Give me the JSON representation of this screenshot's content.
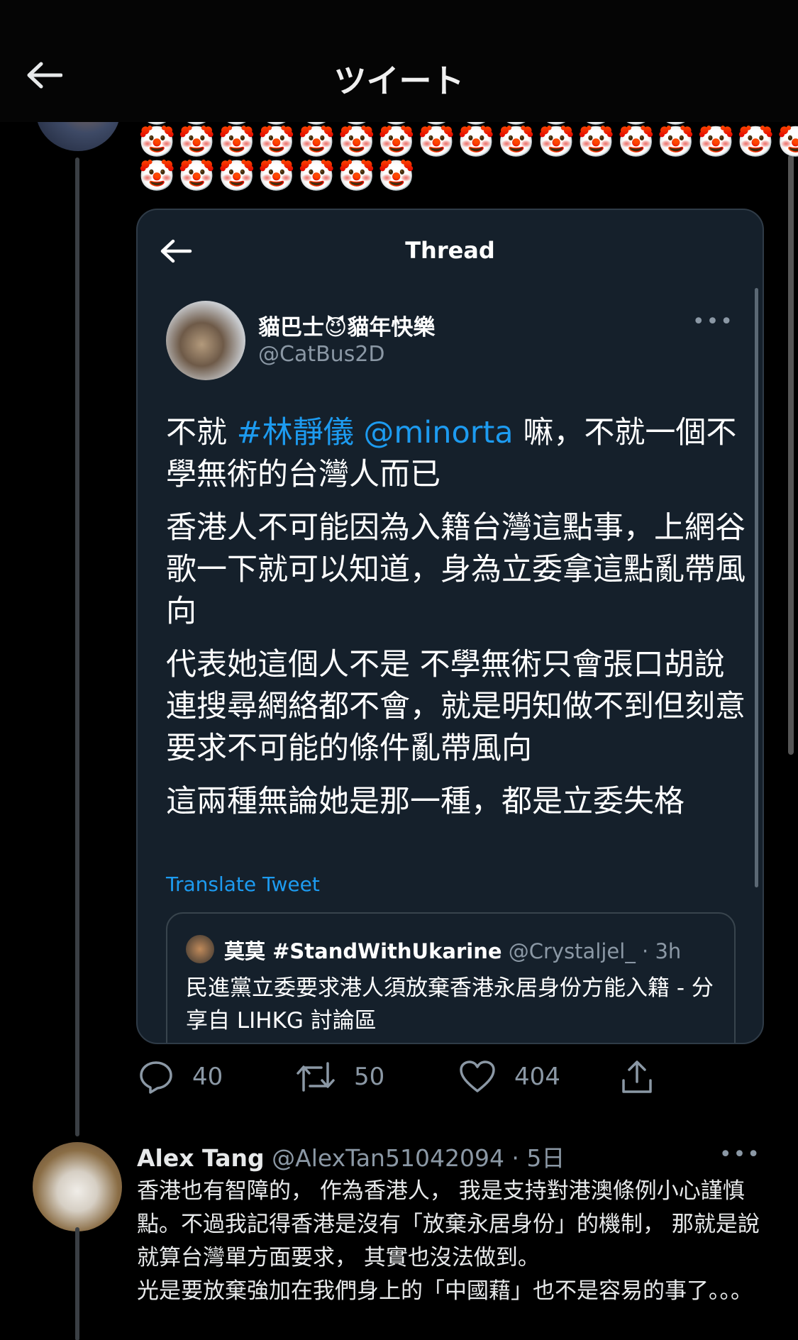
{
  "header": {
    "title": "ツイート"
  },
  "top_tweet": {
    "emoji_row_partial": "🤡🤡🤡🤡🤡🤡🤡🤡🤡🤡🤡🤡🤡🤡",
    "emoji_row_1": "🤡🤡🤡🤡🤡🤡🤡🤡🤡🤡🤡🤡🤡🤡🤡🤡🤡",
    "emoji_row_2": "🤡🤡🤡🤡🤡🤡🤡"
  },
  "embedded": {
    "title": "Thread",
    "author_name": "貓巴士😈貓年快樂",
    "author_handle": "@CatBus2D",
    "more": "•••",
    "p1_prefix": "不就 ",
    "p1_hashtag": "#林靜儀",
    "p1_space": " ",
    "p1_mention": "@minorta",
    "p1_suffix": " 嘛，不就一個不學無術的台灣人而已",
    "p2": "香港人不可能因為入籍台灣這點事，上網谷歌一下就可以知道，身為立委拿這點亂帶風向",
    "p3": "代表她這個人不是 不學無術只會張口胡說連搜尋網絡都不會，就是明知做不到但刻意要求不可能的條件亂帶風向",
    "p4": "這兩種無論她是那一種，都是立委失格",
    "translate": "Translate Tweet",
    "quote": {
      "name": "莫莫 #StandWithUkarine",
      "meta": " @Crystaljel_ · 3h",
      "text": "民進黨立委要求港人須放棄香港永居身份方能入籍 - 分享自 LIHKG 討論區"
    }
  },
  "actions": {
    "replies": "40",
    "retweets": "50",
    "likes": "404"
  },
  "reply": {
    "name": "Alex Tang",
    "meta": " @AlexTan51042094 · 5日",
    "more": "•••",
    "text_1": "香港也有智障的， 作為香港人， 我是支持對港澳條例小心謹慎點。不過我記得香港是沒有「放棄永居身份」的機制， 那就是說就算台灣單方面要求， 其實也沒法做到。",
    "text_2": "光是要放棄強加在我們身上的「中國藉」也不是容易的事了。。。"
  }
}
